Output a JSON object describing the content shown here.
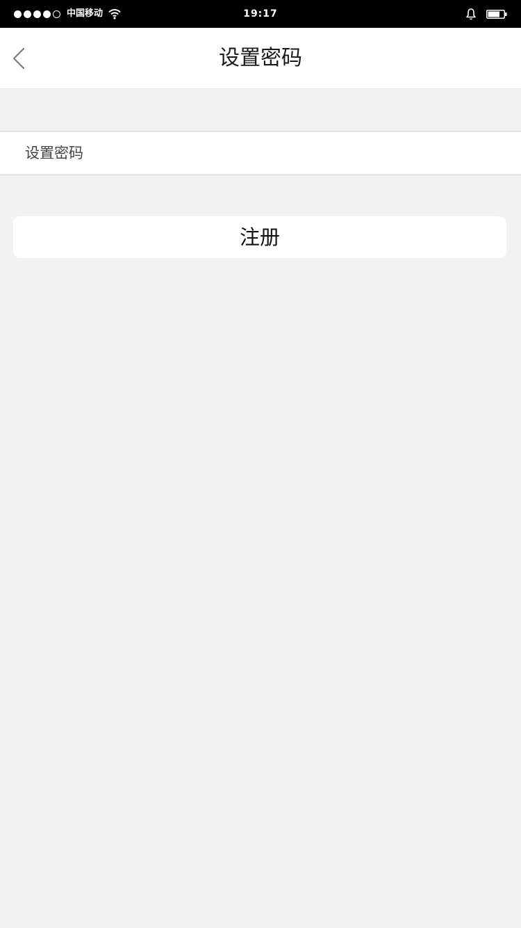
{
  "status_bar": {
    "signal_dots": [
      "filled",
      "filled",
      "filled",
      "filled",
      "empty"
    ],
    "carrier": "中国移动",
    "wifi_icon": "wifi-icon",
    "time": "19:17",
    "bell_icon": "bell-icon",
    "battery_icon": "battery-icon",
    "battery_level": 0.75
  },
  "nav": {
    "back_icon": "chevron-left-icon",
    "title": "设置密码"
  },
  "form": {
    "password_placeholder": "设置密码",
    "password_value": ""
  },
  "actions": {
    "register_label": "注册"
  },
  "colors": {
    "background": "#f2f2f2",
    "surface": "#ffffff",
    "status_bar": "#000000",
    "text": "#1a1a1a"
  }
}
